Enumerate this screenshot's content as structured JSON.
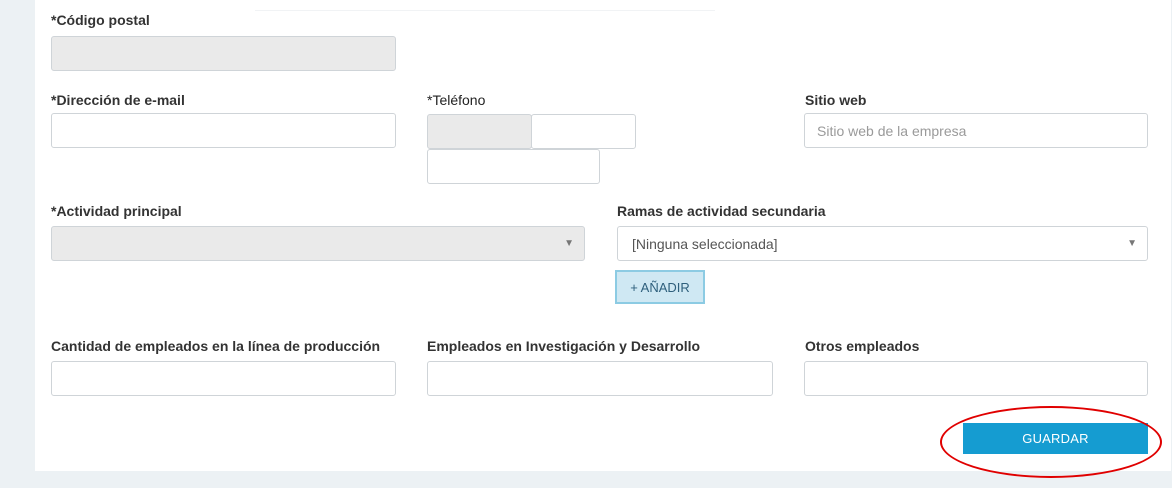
{
  "postal": {
    "label": "*Código postal",
    "value": ""
  },
  "email": {
    "label": "*Dirección de e-mail",
    "value": ""
  },
  "phone": {
    "label": "*Teléfono",
    "code": "",
    "number": "",
    "extra": ""
  },
  "website": {
    "label": "Sitio web",
    "placeholder": "Sitio web de la empresa",
    "value": ""
  },
  "main_activity": {
    "label": "*Actividad principal",
    "selected": ""
  },
  "secondary": {
    "label": "Ramas de actividad secundaria",
    "selected": "[Ninguna seleccionada]",
    "add_label": "+ AÑADIR"
  },
  "employees": {
    "production_label": "Cantidad de empleados en la línea de producción",
    "rd_label": "Empleados en Investigación y Desarrollo",
    "other_label": "Otros empleados"
  },
  "actions": {
    "save_label": "GUARDAR"
  },
  "colors": {
    "primary": "#159cd1",
    "annotation": "#e00000",
    "disabled": "#eaeaea"
  }
}
